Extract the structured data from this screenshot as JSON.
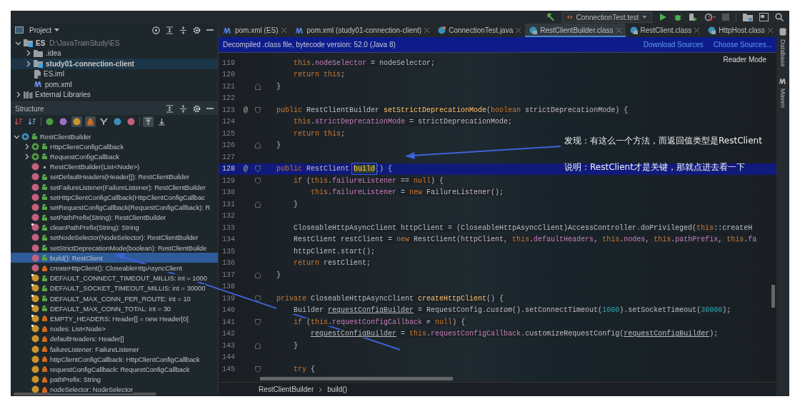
{
  "toolbar": {
    "run_config": "ConnectionTest.test"
  },
  "project_panel": {
    "title": "Project",
    "tree": [
      {
        "label": "ES",
        "path": "D:\\JavaTrainStudy\\ES",
        "kind": "module",
        "expanded": true,
        "selected": false,
        "children": [
          {
            "label": ".idea",
            "kind": "folder",
            "expanded": false,
            "selected": false
          },
          {
            "label": "study01-connection-client",
            "kind": "module",
            "expanded": false,
            "selected": true
          },
          {
            "label": "ES.iml",
            "kind": "file",
            "selected": false
          },
          {
            "label": "pom.xml",
            "kind": "maven",
            "selected": false
          }
        ]
      },
      {
        "label": "External Libraries",
        "kind": "library",
        "expanded": false,
        "selected": false
      }
    ]
  },
  "structure_panel": {
    "title": "Structure",
    "toggles": [
      {
        "on": false
      },
      {
        "on": false
      },
      {
        "on": false
      },
      {
        "on": false
      },
      {
        "on": true
      },
      {
        "on": true
      },
      {
        "on": false
      },
      {
        "on": false
      },
      {
        "on": false
      },
      {
        "on": true
      },
      {
        "on": false
      }
    ],
    "tree": [
      {
        "label": "RestClientBuilder",
        "kind": "class",
        "public": true,
        "private": false,
        "expanded": true,
        "selected": false,
        "children": [
          {
            "label": "HttpClientConfigCallback",
            "kind": "interface",
            "public": true,
            "private": false,
            "expanded": false,
            "selected": false
          },
          {
            "label": "RequestConfigCallback",
            "kind": "interface",
            "public": true,
            "private": false,
            "expanded": false,
            "selected": false
          },
          {
            "label": "RestClientBuilder(List<Node>)",
            "kind": "method",
            "public": false,
            "private": false,
            "selected": false
          },
          {
            "label": "setDefaultHeaders(Header[]): RestClientBuilder",
            "kind": "method",
            "public": true,
            "private": false,
            "selected": false
          },
          {
            "label": "setFailureListener(FailureListener): RestClientBuilder",
            "kind": "method",
            "public": true,
            "private": false,
            "selected": false
          },
          {
            "label": "setHttpClientConfigCallback(HttpClientConfigCallbac",
            "kind": "method",
            "public": true,
            "private": false,
            "selected": false
          },
          {
            "label": "setRequestConfigCallback(RequestConfigCallback): R",
            "kind": "method",
            "public": true,
            "private": false,
            "selected": false
          },
          {
            "label": "setPathPrefix(String): RestClientBuilder",
            "kind": "method",
            "public": true,
            "private": false,
            "selected": false
          },
          {
            "label": "cleanPathPrefix(String): String",
            "kind": "static-method",
            "public": true,
            "private": false,
            "selected": false
          },
          {
            "label": "setNodeSelector(NodeSelector): RestClientBuilder",
            "kind": "method",
            "public": true,
            "private": false,
            "selected": false
          },
          {
            "label": "setStrictDeprecationMode(boolean): RestClientBuilde",
            "kind": "method",
            "public": true,
            "private": false,
            "selected": false
          },
          {
            "label": "build(): RestClient",
            "kind": "method",
            "public": true,
            "private": false,
            "selected": true
          },
          {
            "label": "createHttpClient(): CloseableHttpAsyncClient",
            "kind": "method",
            "public": false,
            "private": true,
            "selected": false
          },
          {
            "label": "DEFAULT_CONNECT_TIMEOUT_MILLIS: int = 1000",
            "kind": "static-field",
            "public": true,
            "private": false,
            "selected": false
          },
          {
            "label": "DEFAULT_SOCKET_TIMEOUT_MILLIS: int = 30000",
            "kind": "static-field",
            "public": true,
            "private": false,
            "selected": false
          },
          {
            "label": "DEFAULT_MAX_CONN_PER_ROUTE: int = 10",
            "kind": "static-field",
            "public": true,
            "private": false,
            "selected": false
          },
          {
            "label": "DEFAULT_MAX_CONN_TOTAL: int = 30",
            "kind": "static-field",
            "public": true,
            "private": false,
            "selected": false
          },
          {
            "label": "EMPTY_HEADERS: Header[] = new Header[0]",
            "kind": "static-field",
            "public": false,
            "private": true,
            "selected": false
          },
          {
            "label": "nodes: List<Node>",
            "kind": "static-field",
            "public": false,
            "private": true,
            "selected": false
          },
          {
            "label": "defaultHeaders: Header[]",
            "kind": "field",
            "public": false,
            "private": true,
            "selected": false
          },
          {
            "label": "failureListener: FailureListener",
            "kind": "field",
            "public": false,
            "private": true,
            "selected": false
          },
          {
            "label": "httpClientConfigCallback: HttpClientConfigCallback",
            "kind": "field",
            "public": false,
            "private": true,
            "selected": false
          },
          {
            "label": "requestConfigCallback: RequestConfigCallback",
            "kind": "field",
            "public": false,
            "private": true,
            "selected": false
          },
          {
            "label": "pathPrefix: String",
            "kind": "field",
            "public": false,
            "private": true,
            "selected": false
          },
          {
            "label": "nodeSelector: NodeSelector",
            "kind": "field",
            "public": false,
            "private": true,
            "selected": false
          }
        ]
      }
    ]
  },
  "editor": {
    "tabs": [
      {
        "label": "pom.xml (ES)",
        "kind": "maven",
        "selected": false
      },
      {
        "label": "pom.xml (study01-connection-client)",
        "kind": "maven",
        "selected": false
      },
      {
        "label": "ConnectionTest.java",
        "kind": "java",
        "selected": false
      },
      {
        "label": "RestClientBuilder.class",
        "kind": "class",
        "selected": true
      },
      {
        "label": "RestClient.class",
        "kind": "class",
        "selected": false
      },
      {
        "label": "HttpHost.class",
        "kind": "class",
        "selected": false
      }
    ],
    "banner": {
      "text": "Decompiled .class file, bytecode version: 52.0 (Java 8)",
      "links": [
        "Download Sources",
        "Choose Sources..."
      ]
    },
    "reader_mode": "Reader Mode",
    "lines": [
      {
        "number": "119",
        "kind": "plain",
        "current": false,
        "tokens": [
          {
            "text": "    this",
            "kind": "kw"
          },
          {
            "text": ".",
            "kind": "p"
          },
          {
            "text": "nodeSelector",
            "kind": "field"
          },
          {
            "text": " = nodeSelector;",
            "kind": "p"
          }
        ]
      },
      {
        "number": "120",
        "kind": "plain",
        "current": false,
        "tokens": [
          {
            "text": "    return this",
            "kind": "kw"
          },
          {
            "text": ";",
            "kind": "p"
          }
        ]
      },
      {
        "number": "121",
        "kind": "fold-end",
        "current": false,
        "tokens": [
          {
            "text": "}",
            "kind": "p"
          }
        ]
      },
      {
        "number": "122",
        "kind": "plain",
        "current": false
      },
      {
        "number": "123",
        "kind": "fold-start",
        "current": false,
        "mark": "@",
        "tokens": [
          {
            "text": "public ",
            "kind": "kw"
          },
          {
            "text": "RestClientBuilder ",
            "kind": "p"
          },
          {
            "text": "setStrictDeprecationMode",
            "kind": "fn"
          },
          {
            "text": "(",
            "kind": "p"
          },
          {
            "text": "boolean ",
            "kind": "kw"
          },
          {
            "text": "strictDeprecationMode) {",
            "kind": "p"
          }
        ]
      },
      {
        "number": "124",
        "kind": "plain",
        "current": false,
        "tokens": [
          {
            "text": "    this",
            "kind": "kw"
          },
          {
            "text": ".",
            "kind": "p"
          },
          {
            "text": "strictDeprecationMode",
            "kind": "field"
          },
          {
            "text": " = strictDeprecationMode;",
            "kind": "p"
          }
        ]
      },
      {
        "number": "125",
        "kind": "plain",
        "current": false,
        "tokens": [
          {
            "text": "    return this",
            "kind": "kw"
          },
          {
            "text": ";",
            "kind": "p"
          }
        ]
      },
      {
        "number": "126",
        "kind": "fold-end",
        "current": false,
        "tokens": [
          {
            "text": "}",
            "kind": "p"
          }
        ]
      },
      {
        "number": "127",
        "kind": "plain",
        "current": false
      },
      {
        "number": "128",
        "kind": "fold-start",
        "current": true,
        "mark": "@",
        "tokens": [
          {
            "text": "public ",
            "kind": "kw"
          },
          {
            "text": "RestClient ",
            "kind": "p"
          },
          {
            "text": "build",
            "kind": "fn",
            "boxed": true
          },
          {
            "text": "() {",
            "kind": "p"
          }
        ]
      },
      {
        "number": "129",
        "kind": "fold-start",
        "current": false,
        "tokens": [
          {
            "text": "    if ",
            "kind": "kw"
          },
          {
            "text": "(",
            "kind": "p"
          },
          {
            "text": "this",
            "kind": "kw"
          },
          {
            "text": ".",
            "kind": "p"
          },
          {
            "text": "failureListener",
            "kind": "field"
          },
          {
            "text": " == ",
            "kind": "p"
          },
          {
            "text": "null",
            "kind": "kw"
          },
          {
            "text": ") {",
            "kind": "p"
          }
        ]
      },
      {
        "number": "130",
        "kind": "plain",
        "current": false,
        "tokens": [
          {
            "text": "        this",
            "kind": "kw"
          },
          {
            "text": ".",
            "kind": "p"
          },
          {
            "text": "failureListener",
            "kind": "field"
          },
          {
            "text": " = ",
            "kind": "p"
          },
          {
            "text": "new ",
            "kind": "kw"
          },
          {
            "text": "FailureListener();",
            "kind": "p"
          }
        ]
      },
      {
        "number": "131",
        "kind": "fold-end",
        "current": false,
        "tokens": [
          {
            "text": "    }",
            "kind": "p"
          }
        ]
      },
      {
        "number": "132",
        "kind": "plain",
        "current": false
      },
      {
        "number": "133",
        "kind": "plain",
        "current": false,
        "tokens": [
          {
            "text": "    CloseableHttpAsyncClient httpClient = (CloseableHttpAsyncClient)AccessController.doPrivileged(",
            "kind": "p"
          },
          {
            "text": "this",
            "kind": "kw"
          },
          {
            "text": "::createH",
            "kind": "p"
          }
        ]
      },
      {
        "number": "134",
        "kind": "plain",
        "current": false,
        "tokens": [
          {
            "text": "    RestClient restClient = ",
            "kind": "p"
          },
          {
            "text": "new ",
            "kind": "kw"
          },
          {
            "text": "RestClient(httpClient, ",
            "kind": "p"
          },
          {
            "text": "this",
            "kind": "kw"
          },
          {
            "text": ".",
            "kind": "p"
          },
          {
            "text": "defaultHeaders",
            "kind": "field"
          },
          {
            "text": ", ",
            "kind": "p"
          },
          {
            "text": "this",
            "kind": "kw"
          },
          {
            "text": ".",
            "kind": "p"
          },
          {
            "text": "nodes",
            "kind": "field"
          },
          {
            "text": ", ",
            "kind": "p"
          },
          {
            "text": "this",
            "kind": "kw"
          },
          {
            "text": ".",
            "kind": "p"
          },
          {
            "text": "pathPrefix",
            "kind": "field"
          },
          {
            "text": ", ",
            "kind": "p"
          },
          {
            "text": "this",
            "kind": "kw"
          },
          {
            "text": ".",
            "kind": "p"
          },
          {
            "text": "fa",
            "kind": "field"
          }
        ]
      },
      {
        "number": "135",
        "kind": "plain",
        "current": false,
        "tokens": [
          {
            "text": "    httpClient.start();",
            "kind": "p"
          }
        ]
      },
      {
        "number": "136",
        "kind": "plain",
        "current": false,
        "tokens": [
          {
            "text": "    return ",
            "kind": "kw"
          },
          {
            "text": "restClient;",
            "kind": "p"
          }
        ]
      },
      {
        "number": "137",
        "kind": "fold-end",
        "current": false,
        "tokens": [
          {
            "text": "}",
            "kind": "p"
          }
        ]
      },
      {
        "number": "138",
        "kind": "plain",
        "current": false
      },
      {
        "number": "139",
        "kind": "fold-start",
        "current": false,
        "tokens": [
          {
            "text": "private ",
            "kind": "kw"
          },
          {
            "text": "CloseableHttpAsyncClient ",
            "kind": "p"
          },
          {
            "text": "createHttpClient",
            "kind": "fn"
          },
          {
            "text": "() {",
            "kind": "p"
          }
        ]
      },
      {
        "number": "140",
        "kind": "plain",
        "current": false,
        "tokens": [
          {
            "text": "    Builder ",
            "kind": "p"
          },
          {
            "text": "requestConfigBuilder",
            "kind": "var"
          },
          {
            "text": " = RequestConfig.",
            "kind": "p"
          },
          {
            "text": "custom",
            "kind": "italic"
          },
          {
            "text": "().setConnectTimeout(",
            "kind": "p"
          },
          {
            "text": "1000",
            "kind": "num"
          },
          {
            "text": ").setSocketTimeout(",
            "kind": "p"
          },
          {
            "text": "30000",
            "kind": "num"
          },
          {
            "text": ");",
            "kind": "p"
          }
        ]
      },
      {
        "number": "141",
        "kind": "fold-start",
        "current": false,
        "tokens": [
          {
            "text": "    if ",
            "kind": "kw"
          },
          {
            "text": "(",
            "kind": "p"
          },
          {
            "text": "this",
            "kind": "kw"
          },
          {
            "text": ".",
            "kind": "p"
          },
          {
            "text": "requestConfigCallback",
            "kind": "field"
          },
          {
            "text": " ≠ ",
            "kind": "p"
          },
          {
            "text": "null",
            "kind": "kw"
          },
          {
            "text": ") {",
            "kind": "p"
          }
        ]
      },
      {
        "number": "142",
        "kind": "plain",
        "current": false,
        "tokens": [
          {
            "text": "        requestConfigBuilder",
            "kind": "var"
          },
          {
            "text": " = ",
            "kind": "p"
          },
          {
            "text": "this",
            "kind": "kw"
          },
          {
            "text": ".",
            "kind": "p"
          },
          {
            "text": "requestConfigCallback",
            "kind": "field"
          },
          {
            "text": ".customizeRequestConfig(",
            "kind": "p"
          },
          {
            "text": "requestConfigBuilder",
            "kind": "var"
          },
          {
            "text": ");",
            "kind": "p"
          }
        ]
      },
      {
        "number": "143",
        "kind": "fold-end",
        "current": false,
        "tokens": [
          {
            "text": "    }",
            "kind": "p"
          }
        ]
      },
      {
        "number": "144",
        "kind": "plain",
        "current": false
      },
      {
        "number": "145",
        "kind": "fold-start",
        "current": false,
        "tokens": [
          {
            "text": "    try ",
            "kind": "kw"
          },
          {
            "text": "{",
            "kind": "p"
          }
        ]
      }
    ],
    "annotations": [
      {
        "text": "发现：有这么一个方法，而返回值类型是RestClient"
      },
      {
        "text": "说明：RestClient才是关键，那就点进去看一下"
      }
    ],
    "breadcrumbs": [
      "RestClientBuilder",
      "build()"
    ]
  },
  "side_strip": [
    "Database",
    "Maven"
  ]
}
